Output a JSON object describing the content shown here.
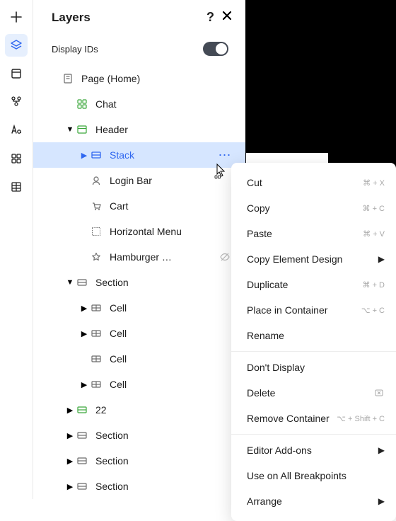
{
  "panel": {
    "title": "Layers",
    "display_ids_label": "Display IDs",
    "display_ids_on": true
  },
  "rail": [
    {
      "name": "add-icon"
    },
    {
      "name": "layers-icon",
      "active": true
    },
    {
      "name": "template-icon"
    },
    {
      "name": "master-icon"
    },
    {
      "name": "font-icon"
    },
    {
      "name": "apps-icon"
    },
    {
      "name": "table-icon"
    }
  ],
  "tree": [
    {
      "indent": 0,
      "caret": "",
      "icon": "page-icon",
      "label": "Page (Home)"
    },
    {
      "indent": 1,
      "caret": "",
      "icon": "chat-icon",
      "label": "Chat"
    },
    {
      "indent": 1,
      "caret": "down",
      "icon": "header-icon",
      "label": "Header"
    },
    {
      "indent": 2,
      "caret": "right",
      "icon": "stack-icon",
      "label": "Stack",
      "selected": true,
      "more": true
    },
    {
      "indent": 2,
      "caret": "",
      "icon": "login-icon",
      "label": "Login Bar"
    },
    {
      "indent": 2,
      "caret": "",
      "icon": "cart-icon",
      "label": "Cart"
    },
    {
      "indent": 2,
      "caret": "",
      "icon": "menu-icon",
      "label": "Horizontal Menu"
    },
    {
      "indent": 2,
      "caret": "",
      "icon": "star-icon",
      "label": "Hamburger …",
      "hidden": true
    },
    {
      "indent": 1,
      "caret": "down",
      "icon": "section-icon",
      "label": "Section"
    },
    {
      "indent": 2,
      "caret": "right",
      "icon": "cell-icon",
      "label": "Cell"
    },
    {
      "indent": 2,
      "caret": "right",
      "icon": "cell-icon",
      "label": "Cell"
    },
    {
      "indent": 2,
      "caret": "",
      "icon": "cell-icon",
      "label": "Cell"
    },
    {
      "indent": 2,
      "caret": "right",
      "icon": "cell-icon",
      "label": "Cell"
    },
    {
      "indent": 1,
      "caret": "right",
      "icon": "section-green-icon",
      "label": "22"
    },
    {
      "indent": 1,
      "caret": "right",
      "icon": "section-icon",
      "label": "Section"
    },
    {
      "indent": 1,
      "caret": "right",
      "icon": "section-icon",
      "label": "Section"
    },
    {
      "indent": 1,
      "caret": "right",
      "icon": "section-icon",
      "label": "Section"
    }
  ],
  "menu": {
    "items": [
      {
        "label": "Cut",
        "shortcut": "⌘ + X"
      },
      {
        "label": "Copy",
        "shortcut": "⌘ + C"
      },
      {
        "label": "Paste",
        "shortcut": "⌘ + V"
      },
      {
        "label": "Copy Element Design",
        "submenu": true
      },
      {
        "label": "Duplicate",
        "shortcut": "⌘ + D"
      },
      {
        "label": "Place in Container",
        "shortcut": "⌥ + C"
      },
      {
        "label": "Rename"
      },
      {
        "separator": true
      },
      {
        "label": "Don't Display"
      },
      {
        "label": "Delete",
        "shortcut_icon": "delete"
      },
      {
        "label": "Remove Container",
        "shortcut": "⌥ + Shift + C"
      },
      {
        "separator": true
      },
      {
        "label": "Editor Add-ons",
        "submenu": true
      },
      {
        "label": "Use on All Breakpoints"
      },
      {
        "label": "Arrange",
        "submenu": true
      }
    ]
  }
}
